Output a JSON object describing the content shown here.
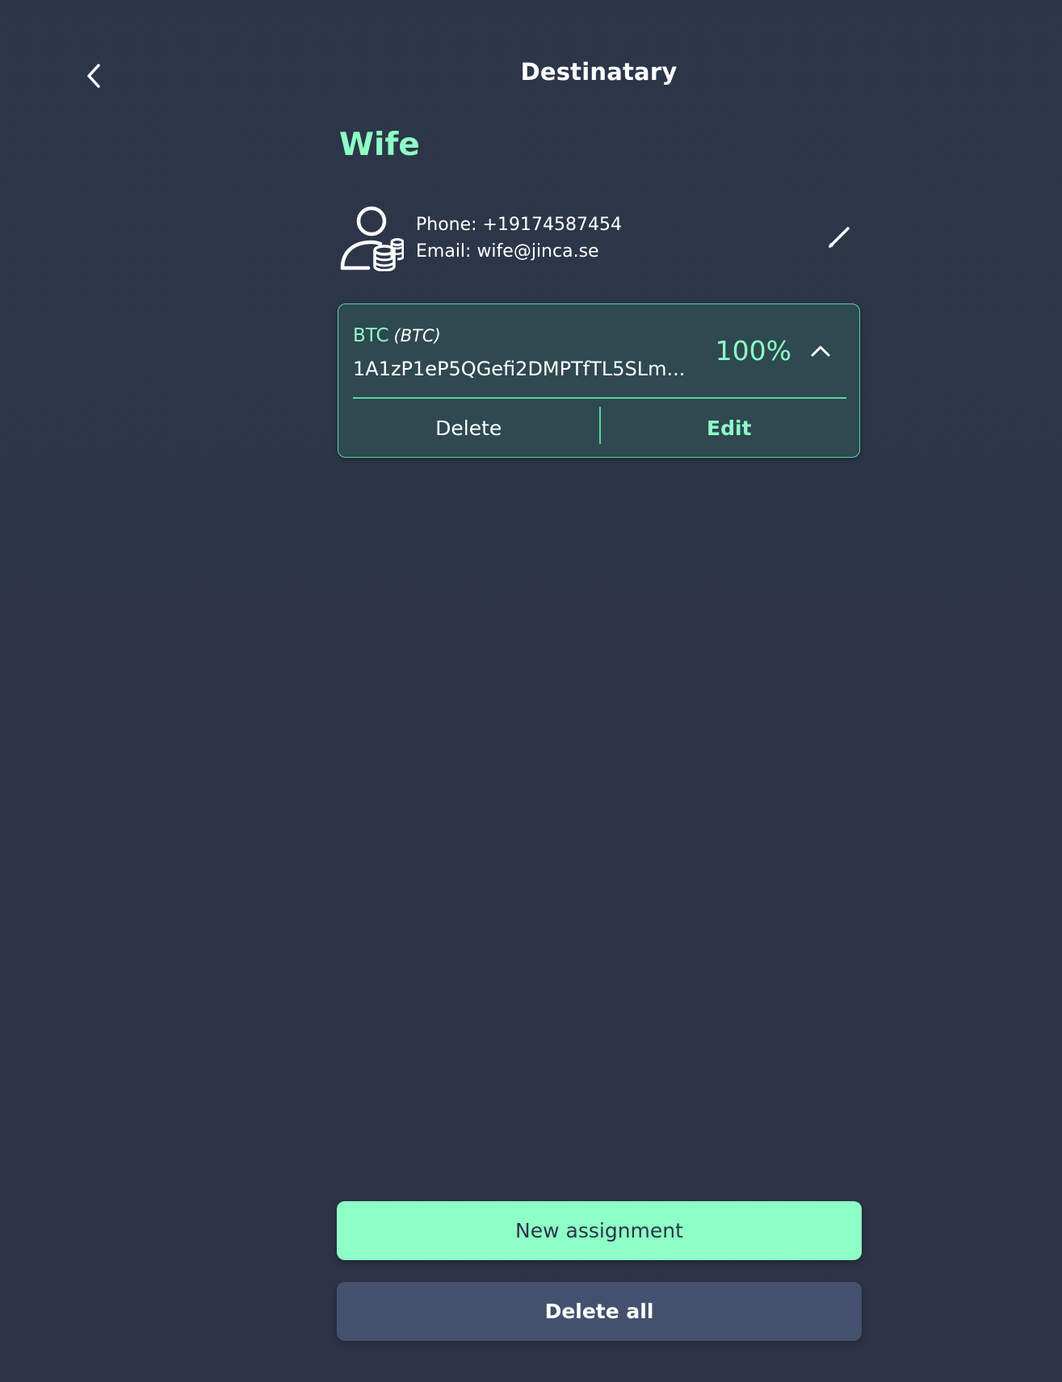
{
  "header": {
    "title": "Destinatary",
    "back_icon": "chevron-left-icon"
  },
  "recipient": {
    "name": "Wife",
    "avatar_icon": "person-with-coins-icon",
    "phone_text": "Phone: +19174587454",
    "email_text": "Email: wife@jinca.se",
    "edit_icon": "pencil-icon"
  },
  "assignment": {
    "asset_name": "BTC",
    "asset_ticker": "(BTC)",
    "address": "1A1zP1eP5QGefi2DMPTfTL5SLm...",
    "percent": "100%",
    "collapse_icon": "chevron-up-icon",
    "delete_label": "Delete",
    "edit_label": "Edit"
  },
  "actions": {
    "new_assignment_label": "New assignment",
    "delete_all_label": "Delete all"
  },
  "colors": {
    "background": "#2d3649",
    "accent": "#8effc6",
    "card_background": "#2e4950",
    "card_border": "#58d6a0",
    "secondary_button": "#43516e"
  }
}
